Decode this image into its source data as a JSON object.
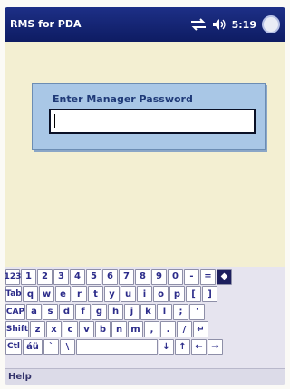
{
  "titlebar": {
    "app_title": "RMS for PDA",
    "clock": "5:19",
    "icons": [
      "sync-icon",
      "speaker-icon",
      "start-icon"
    ]
  },
  "dialog": {
    "label": "Enter Manager Password",
    "password_value": ""
  },
  "keyboard": {
    "rows": [
      [
        "123",
        "1",
        "2",
        "3",
        "4",
        "5",
        "6",
        "7",
        "8",
        "9",
        "0",
        "-",
        "=",
        "◆"
      ],
      [
        "Tab",
        "q",
        "w",
        "e",
        "r",
        "t",
        "y",
        "u",
        "i",
        "o",
        "p",
        "[",
        "]"
      ],
      [
        "CAP",
        "a",
        "s",
        "d",
        "f",
        "g",
        "h",
        "j",
        "k",
        "l",
        ";",
        "'"
      ],
      [
        "Shift",
        "z",
        "x",
        "c",
        "v",
        "b",
        "n",
        "m",
        ",",
        ".",
        "/",
        "↵"
      ],
      [
        "Ctl",
        "áü",
        "`",
        "\\",
        "",
        "↓",
        "↑",
        "←",
        "→"
      ]
    ]
  },
  "menubar": {
    "help_label": "Help"
  }
}
